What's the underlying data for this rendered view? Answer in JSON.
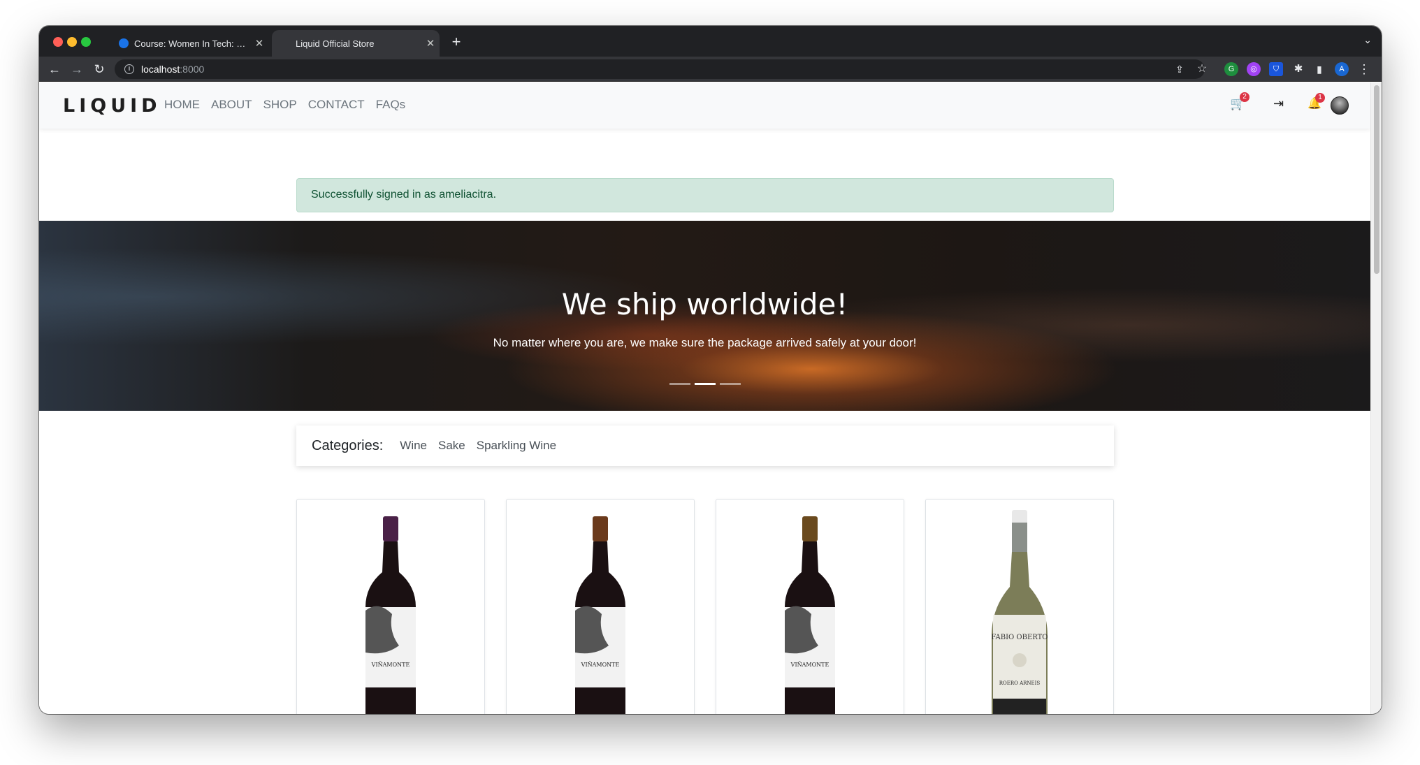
{
  "browser": {
    "tabs": [
      {
        "title": "Course: Women In Tech: Pytho",
        "active": false
      },
      {
        "title": "Liquid Official Store",
        "active": true
      }
    ],
    "address": {
      "host": "localhost",
      "port": ":8000"
    },
    "extension_avatar_letter": "A"
  },
  "site": {
    "logo": "LIQUID",
    "nav": [
      "HOME",
      "ABOUT",
      "SHOP",
      "CONTACT",
      "FAQs"
    ],
    "cart_count": "2",
    "notification_count": "1"
  },
  "alert": {
    "message": "Successfully signed in as ameliacitra."
  },
  "hero": {
    "title": "We ship worldwide!",
    "subtitle": "No matter where you are, we make sure the package arrived safely at your door!",
    "slide_count": 3,
    "active_slide": 2
  },
  "categories": {
    "label": "Categories:",
    "items": [
      "Wine",
      "Sake",
      "Sparkling Wine"
    ]
  },
  "products": [
    {
      "label_text": "VIÑAMONTE",
      "capsule_color": "#4a2147",
      "glass_color": "#1a1012"
    },
    {
      "label_text": "VIÑAMONTE",
      "capsule_color": "#6b3a1c",
      "glass_color": "#1a1012"
    },
    {
      "label_text": "VIÑAMONTE",
      "capsule_color": "#6a4a1e",
      "glass_color": "#1a1012"
    },
    {
      "label_text": "FABIO OBERTO",
      "label_sub": "ROERO ARNEIS",
      "capsule_color": "#8a8f8a",
      "glass_color": "#7c7d58"
    }
  ],
  "colors": {
    "alert_bg": "#d1e7dd",
    "alert_text": "#0f5132",
    "badge": "#dc3545"
  }
}
